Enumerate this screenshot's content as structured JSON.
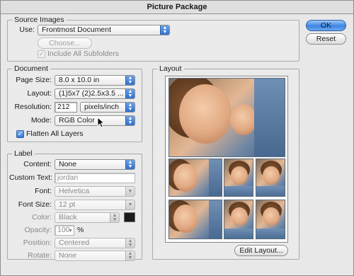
{
  "window": {
    "title": "Picture Package"
  },
  "buttons": {
    "ok": "OK",
    "reset": "Reset",
    "choose": "Choose...",
    "edit_layout": "Edit Layout..."
  },
  "source_images": {
    "group_title": "Source Images",
    "use_label": "Use:",
    "use_value": "Frontmost Document",
    "include_subfolders_label": "Include All Subfolders",
    "include_subfolders_checked": true
  },
  "document": {
    "group_title": "Document",
    "page_size_label": "Page Size:",
    "page_size_value": "8.0 x 10.0 in",
    "layout_label": "Layout:",
    "layout_value": "(1)5x7 (2)2.5x3.5 ...",
    "resolution_label": "Resolution:",
    "resolution_value": "212",
    "resolution_unit": "pixels/inch",
    "mode_label": "Mode:",
    "mode_value": "RGB Color",
    "flatten_label": "Flatten All Layers",
    "flatten_checked": true
  },
  "label": {
    "group_title": "Label",
    "content_label": "Content:",
    "content_value": "None",
    "custom_text_label": "Custom Text:",
    "custom_text_value": "jordan",
    "font_label": "Font:",
    "font_value": "Helvetica",
    "font_size_label": "Font Size:",
    "font_size_value": "12 pt",
    "color_label": "Color:",
    "color_value": "Black",
    "opacity_label": "Opacity:",
    "opacity_value": "100",
    "opacity_unit": "%",
    "position_label": "Position:",
    "position_value": "Centered",
    "rotate_label": "Rotate:",
    "rotate_value": "None"
  },
  "layout_preview": {
    "group_title": "Layout"
  },
  "colors": {
    "accent": "#3d86e2",
    "label_swatch": "#1b1b1b"
  }
}
